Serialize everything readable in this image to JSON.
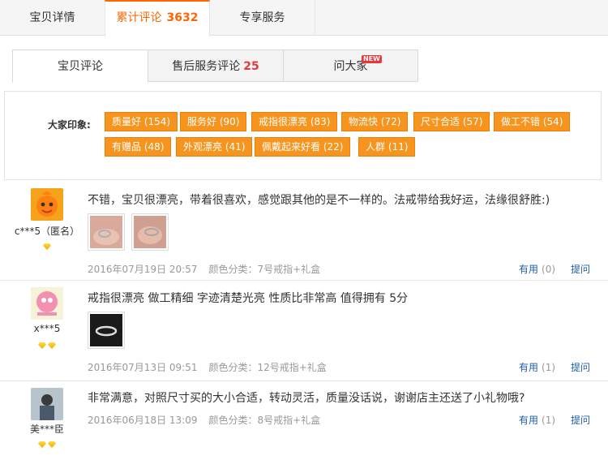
{
  "top_tabs": [
    {
      "label": "宝贝详情"
    },
    {
      "label": "累计评论",
      "count": "3632"
    },
    {
      "label": "专享服务"
    }
  ],
  "sub_tabs": [
    {
      "label": "宝贝评论"
    },
    {
      "label": "售后服务评论",
      "count": "25"
    },
    {
      "label": "问大家",
      "badge": "NEW"
    }
  ],
  "impressions": {
    "label": "大家印象:",
    "tags": [
      "质量好 (154)",
      "服务好 (90)",
      "戒指很漂亮 (83)",
      "物流快 (72)",
      "尺寸合适 (57)",
      "做工不错 (54)",
      "有赠品 (48)",
      "外观漂亮 (41)",
      "佩戴起来好看 (22)",
      "人群 (11)"
    ]
  },
  "reviews": [
    {
      "user": "c***5（匿名）",
      "content": "不错，宝贝很漂亮，带着很喜欢，感觉跟其他的是不一样的。法戒带给我好运，法缘很舒胜:)",
      "date": "2016年07月19日 20:57",
      "spec": "颜色分类：7号戒指+礼盒",
      "useful_label": "有用",
      "useful_count": "(0)",
      "reply_label": "提问"
    },
    {
      "user": "x***5",
      "content": "戒指很漂亮 做工精细 字迹清楚光亮 性质比非常高 值得拥有 5分",
      "date": "2016年07月13日 09:51",
      "spec": "颜色分类：12号戒指+礼盒",
      "useful_label": "有用",
      "useful_count": "(1)",
      "reply_label": "提问"
    },
    {
      "user": "美***臣",
      "content": "非常满意，对照尺寸买的大小合适，转动灵活，质量没话说，谢谢店主还送了小礼物哦?",
      "date": "2016年06月18日 13:09",
      "spec": "颜色分类：8号戒指+礼盒",
      "useful_label": "有用",
      "useful_count": "(1)",
      "reply_label": "提问"
    }
  ],
  "colors": {
    "accent": "#ff6600",
    "tag_bg": "#f7941d",
    "link": "#1e5fa8"
  }
}
